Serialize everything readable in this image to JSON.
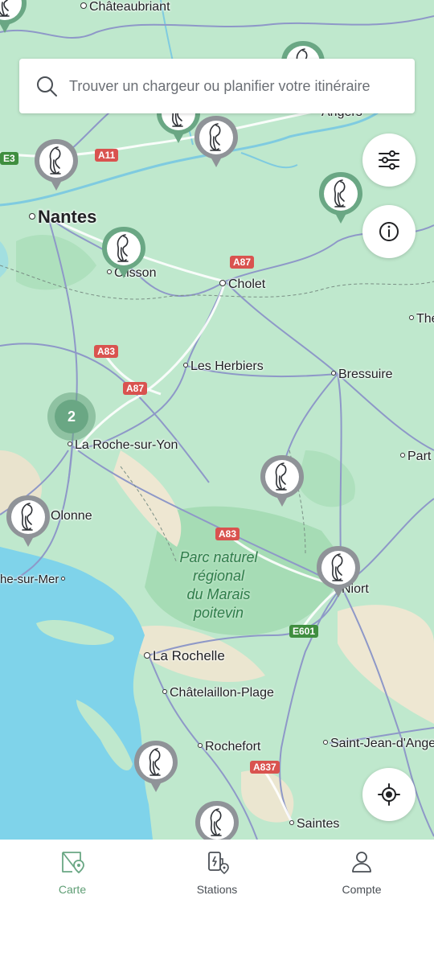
{
  "search": {
    "placeholder": "Trouver un chargeur ou planifier votre itinéraire"
  },
  "map": {
    "places": [
      "Châteaubriant",
      "Angers",
      "Nantes",
      "Clisson",
      "Cholet",
      "The",
      "Les Herbiers",
      "Bressuire",
      "La Roche-sur-Yon",
      "Part",
      "Olonne",
      "he-sur-Mer",
      "Niort",
      "La Rochelle",
      "Châtelaillon-Plage",
      "Rochefort",
      "Saint-Jean-d'Ange",
      "Saintes"
    ],
    "park_label": [
      "Parc naturel",
      "régional",
      "du Marais",
      "poitevin"
    ],
    "road_labels": [
      "E3",
      "A11",
      "A87",
      "A83",
      "A87",
      "A83",
      "E601",
      "A837"
    ],
    "cluster_count": "2"
  },
  "controls": {
    "filter_icon": "sliders-icon",
    "info_icon": "info-icon",
    "locate_icon": "crosshair-icon"
  },
  "nav": {
    "items": [
      {
        "label": "Carte",
        "icon": "map-pin-icon",
        "active": true
      },
      {
        "label": "Stations",
        "icon": "charging-station-icon",
        "active": false
      },
      {
        "label": "Compte",
        "icon": "user-icon",
        "active": false
      }
    ]
  },
  "colors": {
    "land": "#bfe8cd",
    "sea": "#7fd3ea",
    "accent": "#6aa784",
    "pin_gray": "#8f9398"
  }
}
